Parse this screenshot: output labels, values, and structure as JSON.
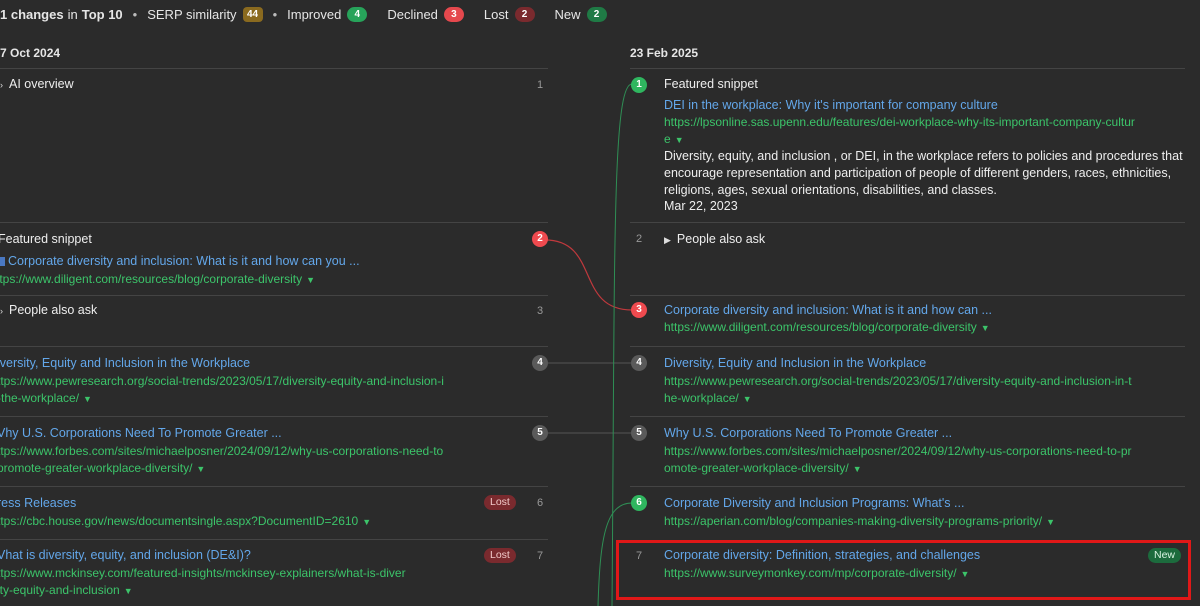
{
  "summary": {
    "changes_text": "1 changes",
    "in_text": "in",
    "top_text": "Top 10",
    "serp_label": "SERP similarity",
    "serp_value": "44",
    "improved_label": "Improved",
    "improved_count": "4",
    "declined_label": "Declined",
    "declined_count": "3",
    "lost_label": "Lost",
    "lost_count": "2",
    "new_label": "New",
    "new_count": "2"
  },
  "left": {
    "date": "7 Oct 2024",
    "rows": [
      {
        "kind": "ai",
        "title": "AI overview",
        "rank": "1"
      },
      {
        "kind": "featured",
        "label": "Featured snippet",
        "title": "Corporate diversity and inclusion: What is it and how can you ...",
        "url": "ttps://www.diligent.com/resources/blog/corporate-diversity",
        "rank": "2"
      },
      {
        "kind": "paa",
        "title": "People also ask",
        "rank": "3"
      },
      {
        "title": "iversity, Equity and Inclusion in the Workplace",
        "url1": "ttps://www.pewresearch.org/social-trends/2023/05/17/diversity-equity-and-inclusion-i",
        "url2": "-the-workplace/",
        "rank": "4"
      },
      {
        "title": "Vhy U.S. Corporations Need To Promote Greater ...",
        "url1": "ttps://www.forbes.com/sites/michaelposner/2024/09/12/why-us-corporations-need-to",
        "url2": "promote-greater-workplace-diversity/",
        "rank": "5"
      },
      {
        "title": "ress Releases",
        "url": "ttps://cbc.house.gov/news/documentsingle.aspx?DocumentID=2610",
        "rank": "6",
        "tag": "Lost"
      },
      {
        "title": "Vhat is diversity, equity, and inclusion (DE&I)?",
        "url1": "ttps://www.mckinsey.com/featured-insights/mckinsey-explainers/what-is-diver",
        "url2": "ity-equity-and-inclusion",
        "rank": "7",
        "tag": "Lost"
      }
    ]
  },
  "right": {
    "date": "23 Feb 2025",
    "featured": {
      "rank": "1",
      "label": "Featured snippet",
      "title": "DEI in the workplace: Why it's important for company culture",
      "url1": "https://lpsonline.sas.upenn.edu/features/dei-workplace-why-its-important-company-cultur",
      "url2": "e",
      "snippet": "Diversity, equity, and inclusion , or DEI, in the workplace refers to policies and procedures that encourage representation and participation of people of different genders, races, ethnicities, religions, ages, sexual orientations, disabilities, and classes.",
      "date": "Mar 22, 2023"
    },
    "paa": {
      "rank": "2",
      "title": "People also ask"
    },
    "rows": [
      {
        "rank": "3",
        "title": "Corporate diversity and inclusion: What is it and how can ...",
        "url": "https://www.diligent.com/resources/blog/corporate-diversity"
      },
      {
        "rank": "4",
        "title": "Diversity, Equity and Inclusion in the Workplace",
        "url1": "https://www.pewresearch.org/social-trends/2023/05/17/diversity-equity-and-inclusion-in-t",
        "url2": "he-workplace/"
      },
      {
        "rank": "5",
        "title": "Why U.S. Corporations Need To Promote Greater ...",
        "url1": "https://www.forbes.com/sites/michaelposner/2024/09/12/why-us-corporations-need-to-pr",
        "url2": "omote-greater-workplace-diversity/"
      },
      {
        "rank": "6",
        "title": "Corporate Diversity and Inclusion Programs: What's ...",
        "url": "https://aperian.com/blog/companies-making-diversity-programs-priority/"
      },
      {
        "rank": "7",
        "title": "Corporate diversity: Definition, strategies, and challenges",
        "url": "https://www.surveymonkey.com/mp/corporate-diversity/",
        "tag": "New"
      }
    ]
  },
  "colors": {
    "green": "#3cc46a",
    "link": "#63a7ea",
    "red": "#ef4a4f",
    "highlight": "#e01818"
  }
}
